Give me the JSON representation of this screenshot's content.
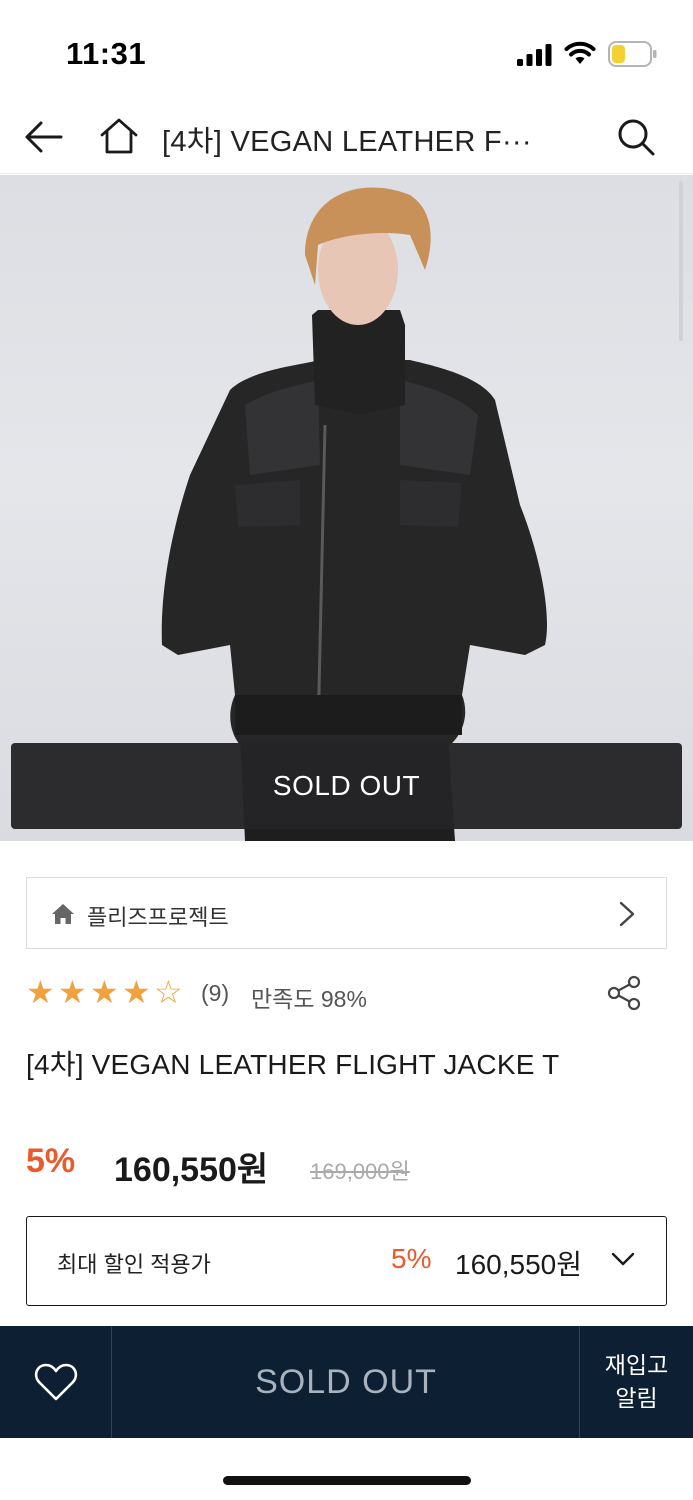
{
  "status_bar": {
    "time": "11:31",
    "icons": [
      "signal-icon",
      "wifi-icon",
      "battery-icon"
    ],
    "battery_color": "#f5d033"
  },
  "header": {
    "back_icon": "arrow-left-icon",
    "home_icon": "home-icon",
    "title": "[4차] VEGAN LEATHER F···",
    "search_icon": "search-icon"
  },
  "product_image": {
    "sold_out_label": "SOLD OUT"
  },
  "brand": {
    "icon": "home-icon",
    "name": "플리즈프로젝트",
    "chevron": "chevron-right-icon"
  },
  "rating": {
    "stars_filled": 4,
    "stars_total": 5,
    "review_count": "(9)",
    "satisfaction": "만족도 98%",
    "star_color": "#f0a23c",
    "share_icon": "share-icon"
  },
  "product": {
    "title": "[4차] VEGAN LEATHER FLIGHT JACKE T"
  },
  "price": {
    "discount_rate": "5%",
    "sale_price": "160,550원",
    "original_price": "169,000원",
    "accent_color": "#ea5a2a"
  },
  "max_discount": {
    "label": "최대 할인 적용가",
    "rate": "5%",
    "price": "160,550원",
    "chevron": "chevron-down-icon"
  },
  "bottom_bar": {
    "wish_icon": "heart-icon",
    "sold_out_label": "SOLD OUT",
    "restock_line1": "재입고",
    "restock_line2": "알림",
    "background": "#0d2033"
  }
}
